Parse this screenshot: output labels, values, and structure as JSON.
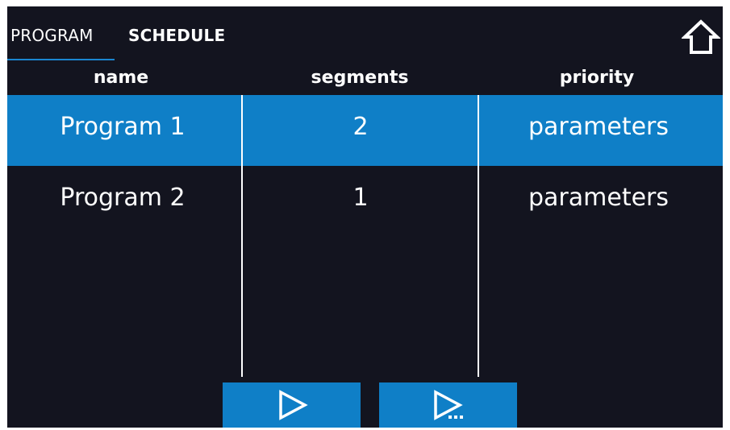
{
  "tabs": [
    {
      "label": "PROGRAM",
      "active": true
    },
    {
      "label": "SCHEDULE",
      "active": false
    }
  ],
  "table": {
    "headers": {
      "name": "name",
      "segments": "segments",
      "priority": "priority"
    },
    "rows": [
      {
        "name": "Program 1",
        "segments": "2",
        "priority": "parameters",
        "selected": true
      },
      {
        "name": "Program 2",
        "segments": "1",
        "priority": "parameters",
        "selected": false
      }
    ]
  },
  "icons": {
    "home": "home-icon",
    "start": "play-icon",
    "start_from": "play-from-segment-icon"
  },
  "colors": {
    "background": "#13141f",
    "accent": "#0f7fc7",
    "text": "#ffffff"
  }
}
